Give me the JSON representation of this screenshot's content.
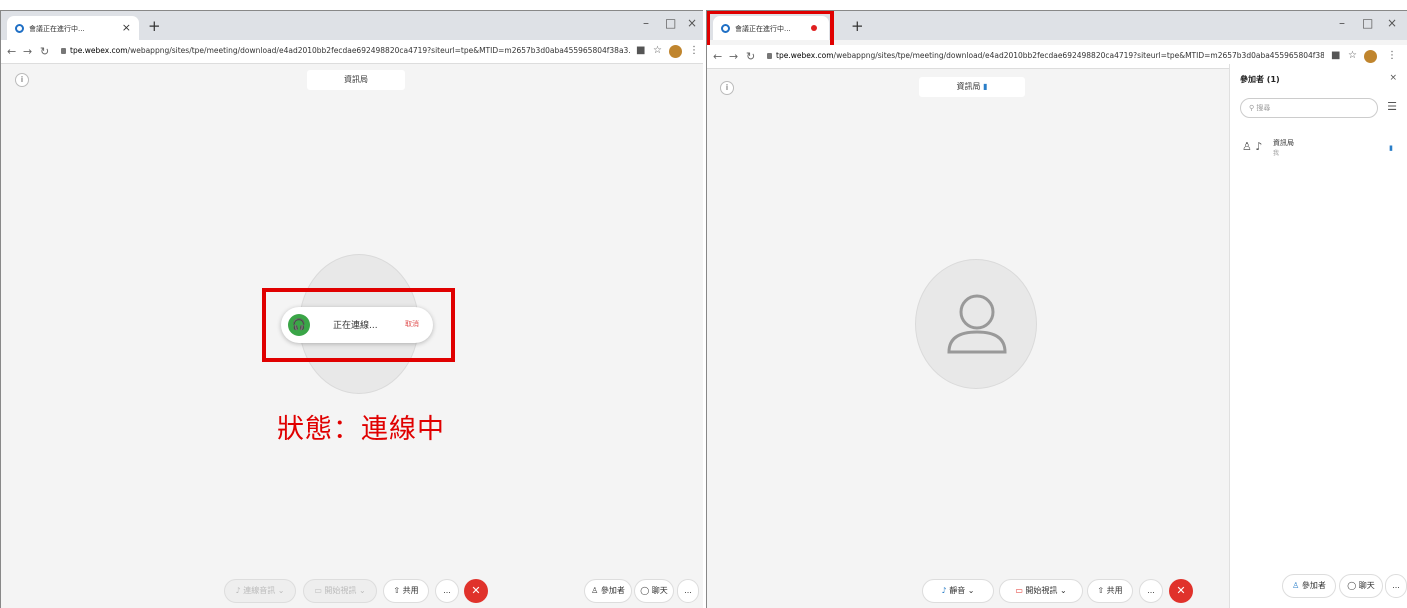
{
  "left": {
    "tab_title": "會議正在進行中...",
    "tab_close": "×",
    "new_tab": "+",
    "win_controls": [
      "–",
      "□",
      "×"
    ],
    "url_host": "tpe.webex.com",
    "url_path": "/webappng/sites/tpe/meeting/download/e4ad2010bb2fecdae692498820ca4719?siteurl=tpe&MTID=m2657b3d0aba455965804f38a3...",
    "room_name": "資訊局",
    "connecting_text": "正在連線...",
    "cancel_text": "取消",
    "status_caption": "狀態：連線中",
    "toolbar": {
      "audio": "連線音訊",
      "video": "開始視訊",
      "share": "共用",
      "more": "...",
      "participants": "參加者",
      "chat": "聊天",
      "more2": "..."
    }
  },
  "right": {
    "tab_title": "會議正在進行中...",
    "new_tab": "+",
    "win_controls": [
      "–",
      "□",
      "×"
    ],
    "url_host": "tpe.webex.com",
    "url_path": "/webappng/sites/tpe/meeting/download/e4ad2010bb2fecdae692498820ca4719?siteurl=tpe&MTID=m2657b3d0aba455965804f38a3...",
    "room_name": "資訊局",
    "toolbar": {
      "mute": "靜音",
      "video": "開始視訊",
      "share": "共用",
      "more": "...",
      "participants": "參加者",
      "chat": "聊天",
      "more2": "..."
    },
    "panel": {
      "title": "參加者 (1)",
      "close": "×",
      "search_placeholder": "搜尋",
      "participant_name": "資訊局",
      "participant_role": "我"
    }
  },
  "colors": {
    "highlight": "#e00000",
    "end_call": "#e0322b",
    "connect_icon": "#3aa547"
  }
}
